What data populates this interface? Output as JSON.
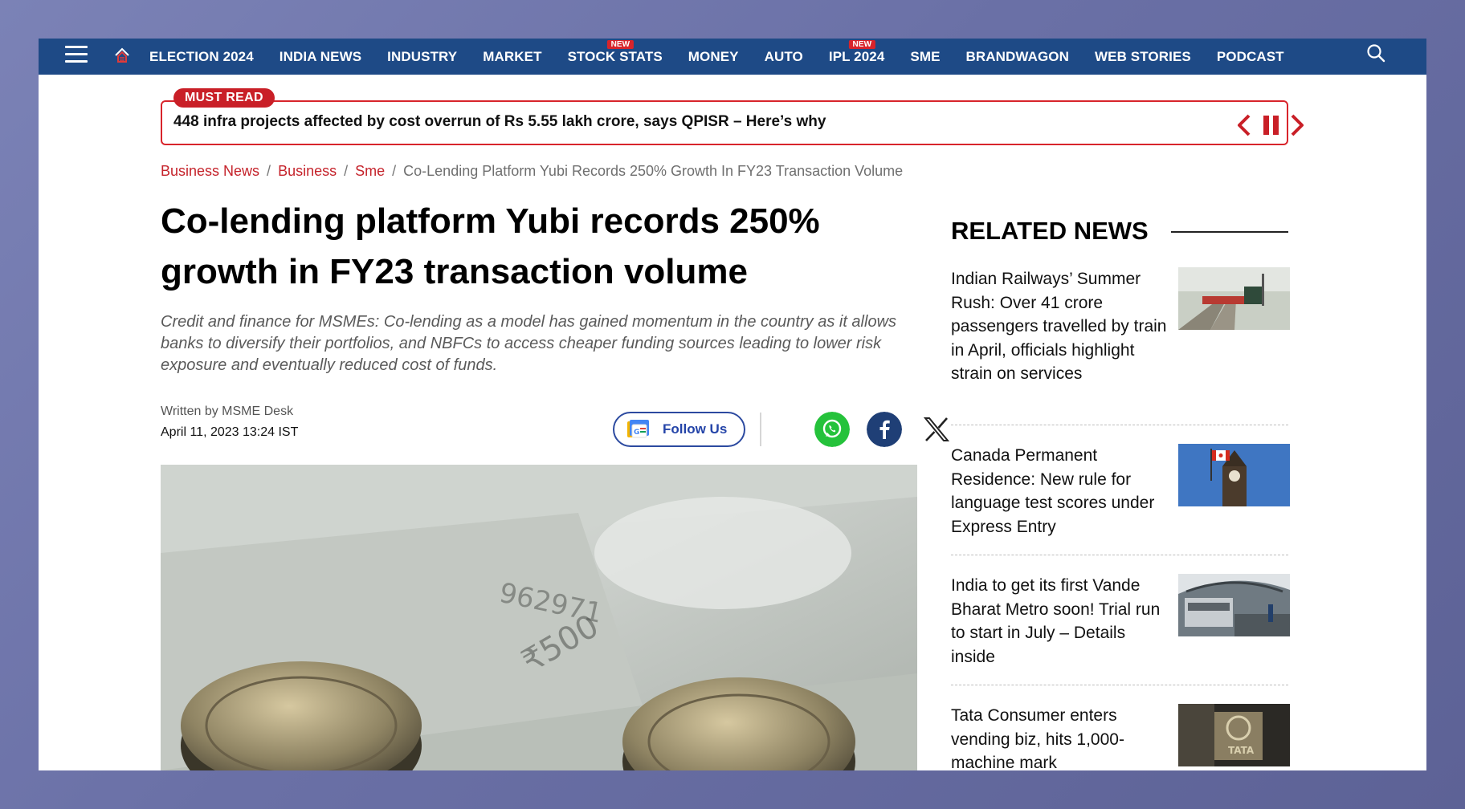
{
  "nav": {
    "items": [
      {
        "label": "ELECTION 2024",
        "badge": ""
      },
      {
        "label": "INDIA NEWS",
        "badge": ""
      },
      {
        "label": "INDUSTRY",
        "badge": ""
      },
      {
        "label": "MARKET",
        "badge": ""
      },
      {
        "label": "STOCK STATS",
        "badge": "NEW"
      },
      {
        "label": "MONEY",
        "badge": ""
      },
      {
        "label": "AUTO",
        "badge": ""
      },
      {
        "label": "IPL 2024",
        "badge": "NEW"
      },
      {
        "label": "SME",
        "badge": ""
      },
      {
        "label": "BRANDWAGON",
        "badge": ""
      },
      {
        "label": "WEB STORIES",
        "badge": ""
      },
      {
        "label": "PODCAST",
        "badge": ""
      }
    ],
    "icons": {
      "menu": "hamburger-icon",
      "home": "home-icon",
      "search": "search-icon"
    }
  },
  "must_read": {
    "tag": "MUST READ",
    "headline": "448 infra projects affected by cost overrun of Rs 5.55 lakh crore, says QPISR – Here’s why"
  },
  "breadcrumb": {
    "items": [
      "Business News",
      "Business",
      "Sme"
    ],
    "current": "Co-Lending Platform Yubi Records 250% Growth In FY23 Transaction Volume"
  },
  "article": {
    "headline_line1": "Co-lending platform Yubi records 250%",
    "headline_line2": "growth in FY23 transaction volume",
    "summary": "Credit and finance for MSMEs: Co-lending as a model has gained momentum in the country as it allows banks to diversify their portfolios, and NBFCs to access cheaper funding sources leading to lower risk exposure and eventually reduced cost of funds.",
    "byline": "Written by MSME Desk",
    "date": "April 11, 2023 13:24 IST",
    "follow_label": "Follow Us"
  },
  "related": {
    "title": "RELATED NEWS",
    "items": [
      "Indian Railways’ Summer Rush: Over 41 crore passengers travelled by train in April, officials highlight strain on services",
      "Canada Permanent Residence: New rule for language test scores under Express Entry",
      "India to get its first Vande Bharat Metro soon! Trial run to start in July – Details inside",
      "Tata Consumer enters vending biz, hits 1,000-machine mark"
    ]
  },
  "colors": {
    "nav_bg": "#1e4a86",
    "accent_red": "#d8242b",
    "follow_blue": "#2444a8",
    "whatsapp": "#25c23b",
    "facebook": "#1f3f76"
  }
}
